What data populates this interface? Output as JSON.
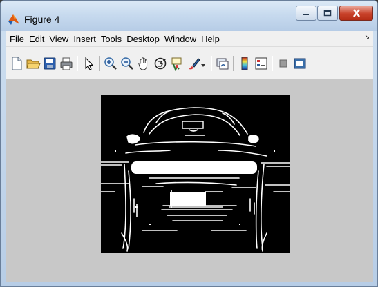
{
  "window": {
    "title": "Figure 4",
    "icon": "matlab-icon"
  },
  "title_buttons": [
    "minimize-icon",
    "maximize-icon",
    "close-icon"
  ],
  "menu": {
    "items": [
      "File",
      "Edit",
      "View",
      "Insert",
      "Tools",
      "Desktop",
      "Window",
      "Help"
    ],
    "overflow_glyph": "↘"
  },
  "toolbar": {
    "buttons": [
      "new-figure-icon",
      "open-file-icon",
      "save-icon",
      "print-icon",
      "edit-plot-arrow-icon",
      "zoom-in-icon",
      "zoom-out-icon",
      "pan-hand-icon",
      "rotate-3d-icon",
      "data-cursor-icon",
      "brush-icon",
      "link-plot-icon",
      "colorbar-icon",
      "legend-icon",
      "hide-plot-tools-icon",
      "show-plot-tools-icon"
    ]
  },
  "figure": {
    "content": "binary edge-detection image of a car front on black background",
    "background": "#c8c8c8",
    "image_colors": {
      "background": "#000000",
      "edges": "#ffffff"
    }
  }
}
